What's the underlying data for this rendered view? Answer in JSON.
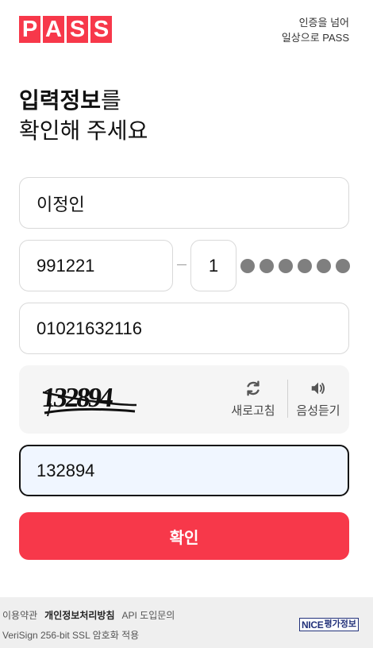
{
  "header": {
    "logo_letters": [
      "P",
      "A",
      "S",
      "S"
    ],
    "tagline_line1": "인증을 넘어",
    "tagline_line2": "일상으로 PASS"
  },
  "title": {
    "bold": "입력정보",
    "rest_line1": "를",
    "line2": "확인해 주세요"
  },
  "form": {
    "name_value": "이정인",
    "birth_value": "991221",
    "gender_digit": "1",
    "masked_digit_count": 6,
    "phone_value": "01021632116",
    "captcha_input_value": "132894"
  },
  "captcha": {
    "image_text": "132894",
    "refresh_label": "새로고침",
    "audio_label": "음성듣기"
  },
  "confirm_button": "확인",
  "footer": {
    "terms": "이용약관",
    "privacy": "개인정보처리방침",
    "api": "API 도입문의",
    "security": "VeriSign 256-bit SSL 암호화 적용",
    "nice_part1": "NICE",
    "nice_part2": "평가정보"
  },
  "colors": {
    "brand": "#f7384a",
    "focus_border": "#111111",
    "focus_bg": "#f0f6ff",
    "masked_dot": "#7f7f7f"
  }
}
